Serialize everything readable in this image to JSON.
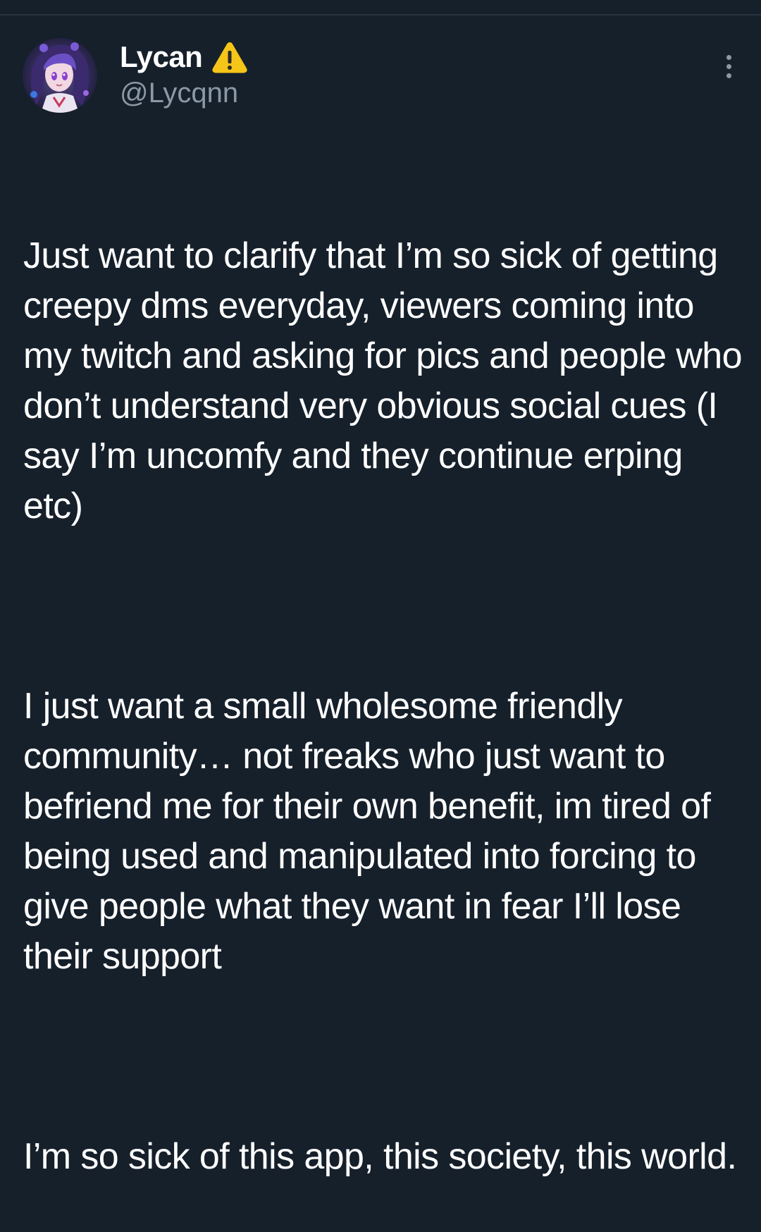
{
  "tweet": {
    "author": {
      "display_name": "Lycan",
      "badge_icon": "warning-icon",
      "handle": "@Lycqnn",
      "avatar_icon": "anime-avatar"
    },
    "menu_icon": "more-vertical-icon",
    "paragraphs": [
      "Just want to clarify that I’m so sick of getting creepy dms everyday, viewers coming into my twitch and asking for pics and people who don’t understand very obvious social cues (I say I’m uncomfy and they continue erping etc)",
      "I just want a small wholesome friendly community… not freaks who just want to befriend me for their own benefit, im tired of being used and manipulated into forcing to give people what they want in fear I’ll lose their support",
      "I’m so sick of this app, this society, this world."
    ]
  },
  "colors": {
    "background": "#16202b",
    "text": "#ffffff",
    "secondary_text": "#8b98a5",
    "warning": "#f5c518"
  }
}
